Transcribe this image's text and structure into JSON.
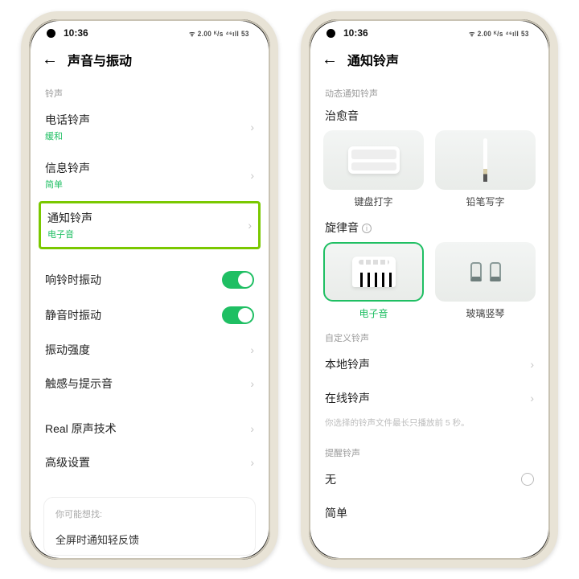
{
  "status": {
    "time": "10:36",
    "icons": "ᯤ 2.00 ᴷ/s  ⁴⁶ıll  53"
  },
  "phone1": {
    "title": "声音与振动",
    "sect_ring": "铃声",
    "items": {
      "call": {
        "t": "电话铃声",
        "s": "缓和"
      },
      "sms": {
        "t": "信息铃声",
        "s": "简单"
      },
      "notif": {
        "t": "通知铃声",
        "s": "电子音"
      },
      "vibRing": {
        "t": "响铃时振动"
      },
      "vibMute": {
        "t": "静音时振动"
      },
      "vibStr": {
        "t": "振动强度"
      },
      "haptic": {
        "t": "触感与提示音"
      },
      "real": {
        "t": "Real 原声技术"
      },
      "adv": {
        "t": "高级设置"
      }
    },
    "hint_title": "你可能想找:",
    "hint_item": "全屏时通知轻反馈"
  },
  "phone2": {
    "title": "通知铃声",
    "sect_dyn": "动态通知铃声",
    "cat_heal": "治愈音",
    "tiles_heal": {
      "kb": "键盘打字",
      "pen": "铅笔写字"
    },
    "cat_mel": "旋律音",
    "tiles_mel": {
      "elec": "电子音",
      "glass": "玻璃竖琴"
    },
    "sect_custom": "自定义铃声",
    "local": "本地铃声",
    "online": "在线铃声",
    "note": "你选择的铃声文件最长只播放前 5 秒。",
    "sect_wake": "提醒铃声",
    "none": "无",
    "simple": "简单"
  }
}
